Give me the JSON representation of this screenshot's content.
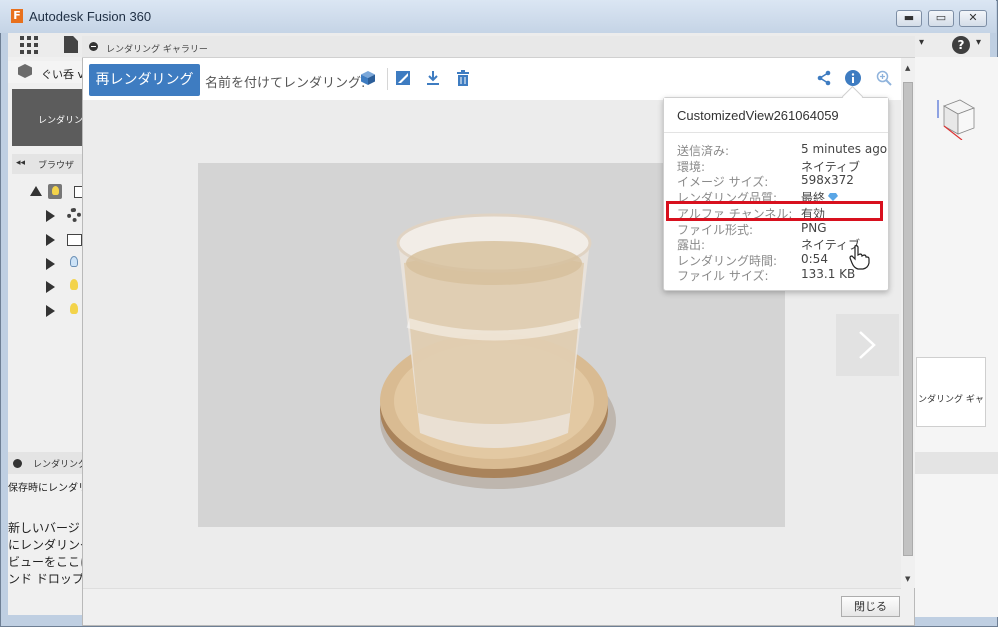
{
  "window": {
    "title": "Autodesk Fusion 360",
    "logo_letter": "F",
    "min_glyph": "▬",
    "max_glyph": "▭",
    "close_glyph": "✕"
  },
  "fusion_toolbar": {
    "help_glyph": "?",
    "caret": "▾",
    "more_caret": "▾"
  },
  "background_panels": {
    "design_tab_label": "ぐい呑 v",
    "workspace_label": "レンダリング",
    "browser_label": "ブラウザ",
    "browser_collapse": "◂◂",
    "render_panel_label": "レンダリング",
    "render_panel_text": [
      "保存時にレンダリ",
      "",
      "新しいバージョ",
      "にレンダリング",
      "ビューをここに",
      "ンド ドロップ"
    ],
    "gallery_side_label": "ンダリング ギャ"
  },
  "dialog": {
    "title": "レンダリング ギャラリー",
    "rerender_label": "再レンダリング",
    "named_render_label": "名前を付けてレンダリング:",
    "close_label": "閉じる",
    "next_glyph": "›",
    "scroll_up": "▲",
    "scroll_down": "▼"
  },
  "info_popup": {
    "title": "CustomizedView261064059",
    "rows": [
      {
        "key": "送信済み:",
        "value": "5 minutes ago"
      },
      {
        "key": "環境:",
        "value": "ネイティブ"
      },
      {
        "key": "イメージ サイズ:",
        "value": "598x372"
      },
      {
        "key": "レンダリング品質:",
        "value": "最終"
      },
      {
        "key": "アルファ チャンネル:",
        "value": "有効"
      },
      {
        "key": "ファイル形式:",
        "value": "PNG"
      },
      {
        "key": "露出:",
        "value": "ネイティブ"
      },
      {
        "key": "レンダリング時間:",
        "value": "0:54"
      },
      {
        "key": "ファイル サイズ:",
        "value": "133.1 KB"
      }
    ]
  },
  "colors": {
    "accent": "#3e7cc1",
    "highlight": "#d8101e",
    "toolbar_icon": "#3e7cc1"
  }
}
